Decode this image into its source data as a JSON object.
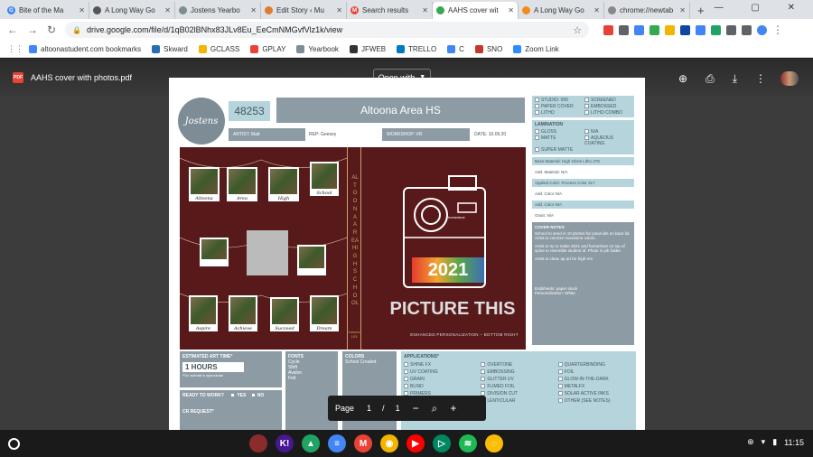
{
  "browser": {
    "tabs": [
      {
        "label": "Bite of the Ma",
        "favicon_color": "#4285f4",
        "favicon_letter": "G"
      },
      {
        "label": "A Long Way Go",
        "favicon_color": "#555555",
        "favicon_letter": ""
      },
      {
        "label": "Jostens Yearbo",
        "favicon_color": "#7d8c95",
        "favicon_letter": ""
      },
      {
        "label": "Edit Story ‹ Mu",
        "favicon_color": "#e07a2e",
        "favicon_letter": ""
      },
      {
        "label": "Search results",
        "favicon_color": "#ea4335",
        "favicon_letter": "M"
      },
      {
        "label": "AAHS cover wit",
        "favicon_color": "#34a853",
        "favicon_letter": ""
      },
      {
        "label": "A Long Way Go",
        "favicon_color": "#f28b1a",
        "favicon_letter": ""
      },
      {
        "label": "chrome://newtab",
        "favicon_color": "#888888",
        "favicon_letter": ""
      }
    ],
    "active_tab_index": 5,
    "new_tab": "+",
    "url": "drive.google.com/file/d/1qB02lBNhx83JLv8Eu_EeCmNMGvfVlz1k/view",
    "bookmarks": [
      {
        "label": "altoonastudent.com bookmarks",
        "color": "#4285f4"
      },
      {
        "label": "Skward",
        "color": "#2b6cb0"
      },
      {
        "label": "GCLASS",
        "color": "#f4b400"
      },
      {
        "label": "GPLAY",
        "color": "#ea4335"
      },
      {
        "label": "Yearbook",
        "color": "#7d8c95"
      },
      {
        "label": "JFWEB",
        "color": "#333333"
      },
      {
        "label": "TRELLO",
        "color": "#0079bf"
      },
      {
        "label": "C",
        "color": "#4285f4"
      },
      {
        "label": "SNO",
        "color": "#c0392b"
      },
      {
        "label": "Zoom Link",
        "color": "#2d8cff"
      }
    ]
  },
  "viewer": {
    "filename": "AAHS cover with photos.pdf",
    "pdf_badge": "PDF",
    "open_with": "Open with",
    "page_label": "Page",
    "page_current": "1",
    "page_sep": "/",
    "page_total": "1"
  },
  "doc": {
    "jostens": "Jostens",
    "job_number": "48253",
    "school": "Altoona Area HS",
    "artist": "ARTIST: Matt",
    "rep": "REP: Geesey",
    "workshop": "WORKSHOP: VR",
    "date": "DATE: 10.09.20",
    "spine_text": "ALTOONA AREA HIGH SCHOOL",
    "volume": "Volume 103",
    "photo_labels": [
      "Altoona",
      "Area",
      "High",
      "School",
      "Aspire",
      "Achieve",
      "Succeed",
      "Dream"
    ],
    "camera_brand": "horseshoe",
    "year": "2021",
    "title": "PICTURE THIS",
    "caption": "ENHANCED PERSONALIZATION – BOTTOM RIGHT",
    "cover_types": [
      "STUDIO: 000",
      "SCREENED",
      "PAPER COVER",
      "EMBOSSED",
      "LITHO",
      "LITHO COMBO"
    ],
    "lamination_head": "LAMINATION",
    "lamination": [
      "GLOSS",
      "N/A",
      "MATTE",
      "AQUEOUS COATING",
      "SUPER MATTE"
    ],
    "base_material": "Base Material: High Gloss Litho 478",
    "add_material": "Add. Material: N/A",
    "applied_color": "Applied Color: Process Color 317",
    "add_color1": "Add. Color N/A",
    "add_color2": "Add. Color N/A",
    "grain": "Grain: N/A",
    "notes_head": "COVER NOTES",
    "notes": [
      "School to send in 10 photos for polaroids on back lid. Artist to colorize monotone colors.",
      "Artist to try to make 2021 and horseshoe on top of spine to resemble student id. Photo in job folder.",
      "Artist to clean up art for high-res"
    ],
    "endsheets": "Endsheets: paper stock",
    "personalization": "Personalization: White",
    "est_art_time_head": "ESTIMATED ART TIME*",
    "est_art_time": "1 HOURS",
    "est_note": "*Est. estimate is approximate",
    "ready_head": "READY TO WORK?",
    "ready_yes": "YES",
    "ready_no": "NO",
    "cr_request": "CR REQUEST*",
    "fonts_head": "FONTS",
    "fonts": [
      "Cycle",
      "Shift",
      "Avalon",
      "Felt"
    ],
    "colors_head": "COLORS",
    "colors_value": "School Created",
    "applications_head": "APPLICATIONS*",
    "applications": [
      "SHINE FX",
      "OVERTONE",
      "QUARTERBINDING",
      "UV COATING",
      "EMBOSSING",
      "FOIL",
      "GRAIN",
      "GLITTER UV",
      "GLOW-IN-THE-DARK",
      "BLIND",
      "FLIMED FOIL",
      "METALFX",
      "PRIMERS",
      "DIVISION CUT",
      "SOLAR ACTIVE INKS",
      "CRACKLE",
      "LENTICULAR",
      "OTHER (SEE NOTES)"
    ]
  },
  "shelf": {
    "time": "11:15",
    "apps": [
      {
        "name": "photo",
        "color": "#8b2c2c",
        "letter": ""
      },
      {
        "name": "kahoot",
        "color": "#46178f",
        "letter": "K!"
      },
      {
        "name": "drive",
        "color": "#1fa463",
        "letter": "▲"
      },
      {
        "name": "docs",
        "color": "#4285f4",
        "letter": "≡"
      },
      {
        "name": "gmail",
        "color": "#ea4335",
        "letter": "M"
      },
      {
        "name": "chrome",
        "color": "#f4b400",
        "letter": "◉"
      },
      {
        "name": "youtube",
        "color": "#ff0000",
        "letter": "▶"
      },
      {
        "name": "play",
        "color": "#01875f",
        "letter": "▷"
      },
      {
        "name": "spotify",
        "color": "#1db954",
        "letter": "≋"
      },
      {
        "name": "keep",
        "color": "#fbbc04",
        "letter": "◌"
      }
    ]
  }
}
